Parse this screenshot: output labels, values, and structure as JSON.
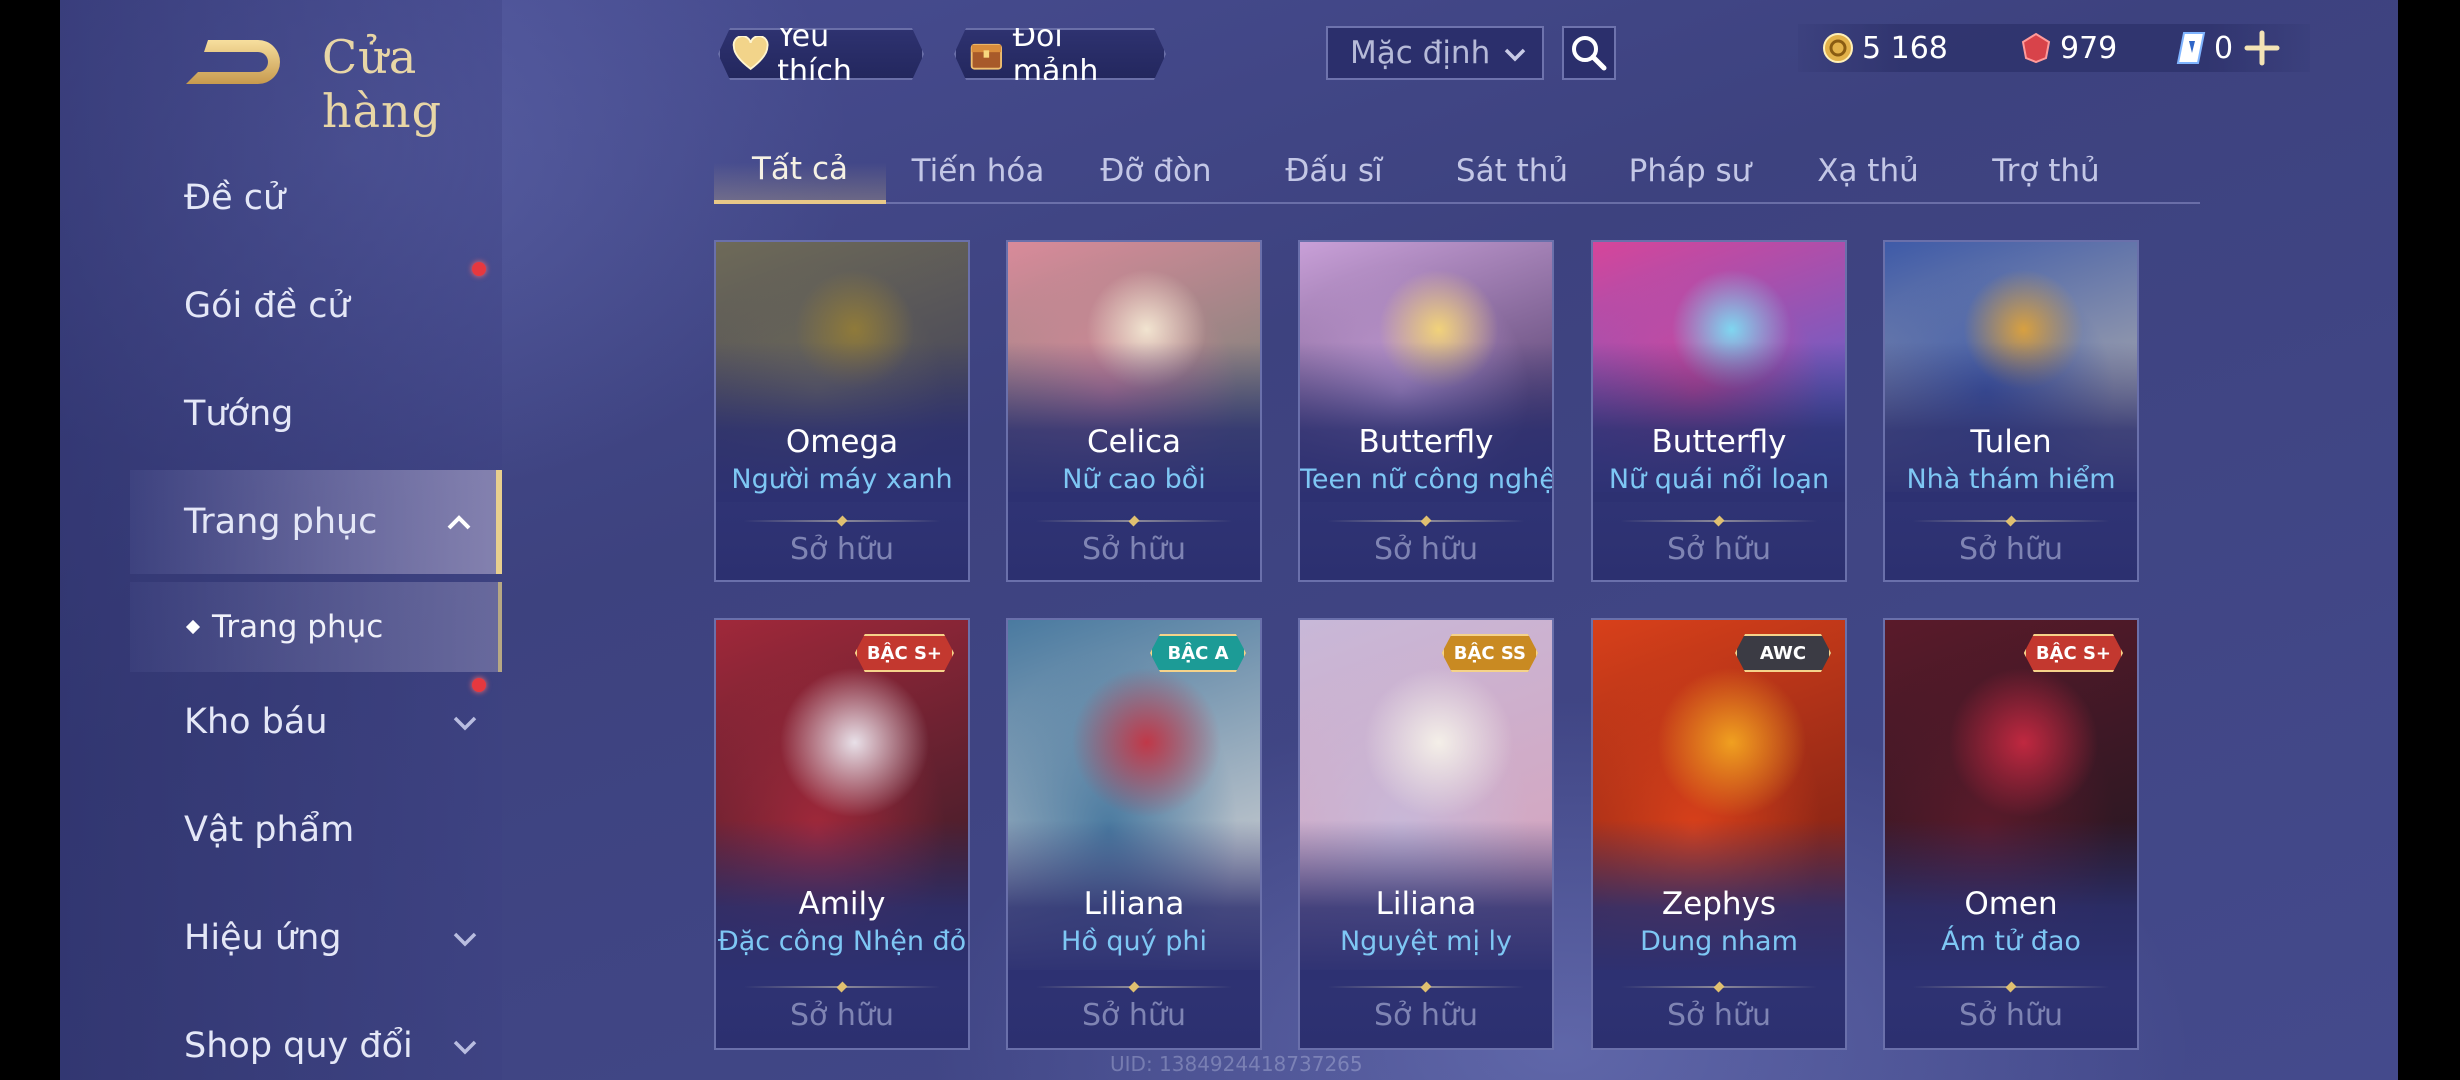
{
  "header": {
    "title": "Cửa hàng",
    "favorites_label": "Yêu thích",
    "exchange_label": "Đổi mảnh",
    "sort_value": "Mặc định"
  },
  "currencies": {
    "gold": "5 168",
    "vouchers": "979",
    "diamonds": "0"
  },
  "sidebar": {
    "items": [
      {
        "label": "Đề cử"
      },
      {
        "label": "Gói đề cử"
      },
      {
        "label": "Tướng"
      },
      {
        "label": "Trang phục"
      },
      {
        "label": "Kho báu"
      },
      {
        "label": "Vật phẩm"
      },
      {
        "label": "Hiệu ứng"
      },
      {
        "label": "Shop quy đổi"
      }
    ],
    "sub_item": "Trang phục"
  },
  "tabs": [
    "Tất cả",
    "Tiến hóa",
    "Đỡ đòn",
    "Đấu sĩ",
    "Sát thủ",
    "Pháp sư",
    "Xạ thủ",
    "Trợ thủ"
  ],
  "cards": [
    {
      "hero": "Omega",
      "skin": "Người máy xanh",
      "status": "Sở hữu",
      "tier": ""
    },
    {
      "hero": "Celica",
      "skin": "Nữ cao bồi",
      "status": "Sở hữu",
      "tier": ""
    },
    {
      "hero": "Butterfly",
      "skin": "Teen nữ công nghệ",
      "status": "Sở hữu",
      "tier": ""
    },
    {
      "hero": "Butterfly",
      "skin": "Nữ quái nổi loạn",
      "status": "Sở hữu",
      "tier": ""
    },
    {
      "hero": "Tulen",
      "skin": "Nhà thám hiểm",
      "status": "Sở hữu",
      "tier": ""
    },
    {
      "hero": "Amily",
      "skin": "Đặc công Nhện đỏ",
      "status": "Sở hữu",
      "tier": "BẬC S+"
    },
    {
      "hero": "Liliana",
      "skin": "Hồ quý phi",
      "status": "Sở hữu",
      "tier": "BẬC A"
    },
    {
      "hero": "Liliana",
      "skin": "Nguyệt mị ly",
      "status": "Sở hữu",
      "tier": "BẬC SS"
    },
    {
      "hero": "Zephys",
      "skin": "Dung nham",
      "status": "Sở hữu",
      "tier": "AWC"
    },
    {
      "hero": "Omen",
      "skin": "Ám tử đao",
      "status": "Sở hữu",
      "tier": "BẬC S+"
    }
  ],
  "uid": "UID: 1384924418737265",
  "colors": {
    "accent_gold": "#e8cf8e",
    "skin_name": "#7ec7f4",
    "badge_red": "#c3382f",
    "badge_teal": "#1c9b96",
    "badge_gold": "#c98a22",
    "badge_dark": "#3b3b44"
  }
}
